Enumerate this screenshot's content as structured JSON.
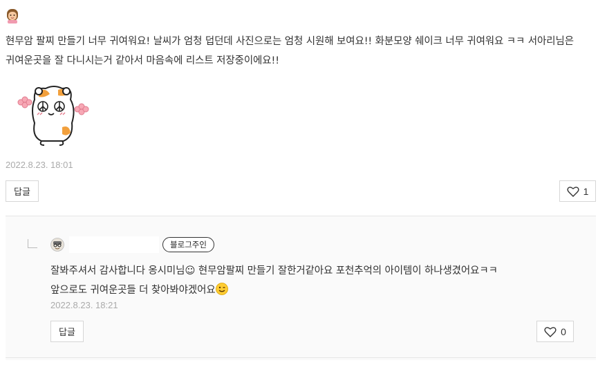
{
  "comment": {
    "avatar_icon": "woman-emoji-icon",
    "text": "현무암 팔찌 만들기 너무 귀여워요! 날씨가 엄청 덥던데 사진으로는 엄청 시원해 보여요!! 화분모양 쉐이크 너무 귀여워요 ㅋㅋ 서아리님은 귀여운곳을 잘 다니시는거 같아서 마음속에 리스트 저장중이에요!!",
    "sticker": "hamster-sticker-icon",
    "date": "2022.8.23. 18:01",
    "reply_label": "답글",
    "like_count": "1"
  },
  "reply": {
    "owner_badge": "블로그주인",
    "text_line1": "잘봐주셔서 감사합니다 옹시미님☺ 현무암팔찌 만들기 잘한거같아요 포천추억의 아이템이 하나생겼어요ㅋㅋ",
    "text_line2": "앞으로도 귀여운곳들 더 찾아봐야겠어요",
    "date": "2022.8.23. 18:21",
    "reply_label": "답글",
    "like_count": "0"
  },
  "colors": {
    "text": "#333333",
    "date": "#aaaaaa",
    "border": "#d6d6d6",
    "reply_bg": "#fafafa"
  }
}
